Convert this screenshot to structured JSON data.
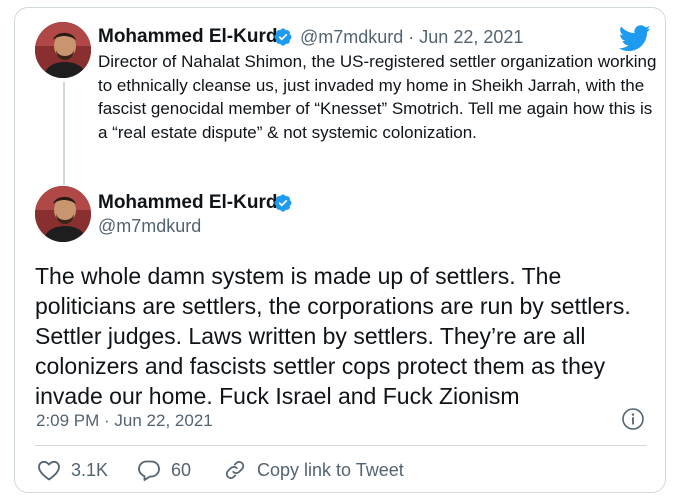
{
  "parent_tweet": {
    "author_name": "Mohammed El-Kurd",
    "handle_and_date": "@m7mdkurd · Jun 22, 2021",
    "text": "Director of Nahalat Shimon, the US-registered settler organization working to ethnically cleanse us, just invaded my home in Sheikh Jarrah, with the fascist genocidal member of “Knesset” Smotrich. Tell me again how this is a “real estate dispute” & not systemic colonization."
  },
  "main_tweet": {
    "author_name": "Mohammed El-Kurd",
    "handle": "@m7mdkurd",
    "text": "The whole damn system is made up of settlers. The politicians are settlers, the corporations are run by settlers. Settler judges. Laws written by settlers. They’re are all colonizers and fascists settler cops protect them as they invade our home. Fuck Israel and Fuck Zionism",
    "timestamp": "2:09 PM · Jun 22, 2021"
  },
  "actions": {
    "likes": "3.1K",
    "replies": "60",
    "copy_link": "Copy link to Tweet"
  },
  "colors": {
    "brand_blue": "#1d9bf0",
    "secondary_text": "#536471",
    "border": "#cfd9de"
  },
  "icons": [
    "twitter-bird-icon",
    "verified-badge-icon",
    "info-icon",
    "heart-icon",
    "reply-icon",
    "link-icon"
  ]
}
